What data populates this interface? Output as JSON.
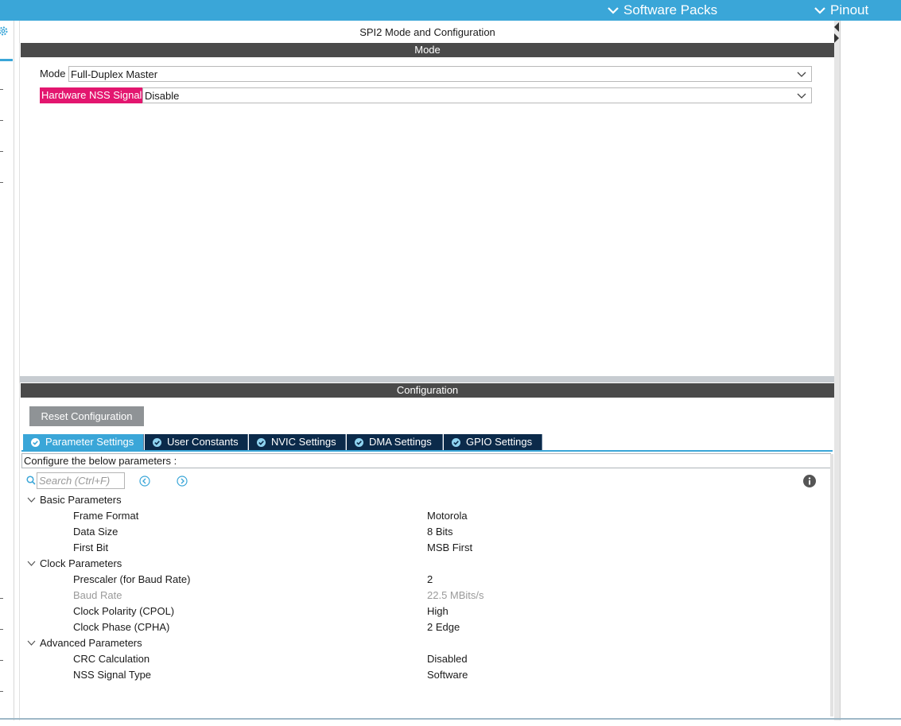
{
  "topbar": {
    "software_packs": "Software Packs",
    "pinout": "Pinout"
  },
  "panel": {
    "title": "SPI2 Mode and Configuration",
    "mode_section": "Mode",
    "mode_label": "Mode",
    "mode_value": "Full-Duplex Master",
    "nss_label": "Hardware NSS Signal",
    "nss_value": "Disable",
    "config_section": "Configuration",
    "reset_button": "Reset Configuration"
  },
  "tabs": [
    {
      "label": "Parameter Settings",
      "active": true
    },
    {
      "label": "User Constants",
      "active": false
    },
    {
      "label": "NVIC Settings",
      "active": false
    },
    {
      "label": "DMA Settings",
      "active": false
    },
    {
      "label": "GPIO Settings",
      "active": false
    }
  ],
  "params": {
    "configure_text": "Configure the below parameters :",
    "search_placeholder": "Search (Ctrl+F)",
    "groups": [
      {
        "name": "Basic Parameters",
        "items": [
          {
            "name": "Frame Format",
            "value": "Motorola"
          },
          {
            "name": "Data Size",
            "value": "8 Bits"
          },
          {
            "name": "First Bit",
            "value": "MSB First"
          }
        ]
      },
      {
        "name": "Clock Parameters",
        "items": [
          {
            "name": "Prescaler (for Baud Rate)",
            "value": "2"
          },
          {
            "name": "Baud Rate",
            "value": "22.5 MBits/s"
          },
          {
            "name": "Clock Polarity (CPOL)",
            "value": "High"
          },
          {
            "name": "Clock Phase (CPHA)",
            "value": "2 Edge"
          }
        ]
      },
      {
        "name": "Advanced Parameters",
        "items": [
          {
            "name": "CRC Calculation",
            "value": "Disabled"
          },
          {
            "name": "NSS Signal Type",
            "value": "Software"
          }
        ]
      }
    ]
  },
  "colors": {
    "accent": "#3aa6d8",
    "nss_highlight": "#e3166f",
    "tab_dark": "#0b2a4a",
    "section_bar": "#4a4a4a"
  },
  "icons": [
    "chevron-down-icon",
    "gear-icon",
    "check-circle-icon",
    "search-icon",
    "arrow-left-circle-icon",
    "arrow-right-circle-icon",
    "info-icon",
    "collapse-arrow-icon"
  ]
}
